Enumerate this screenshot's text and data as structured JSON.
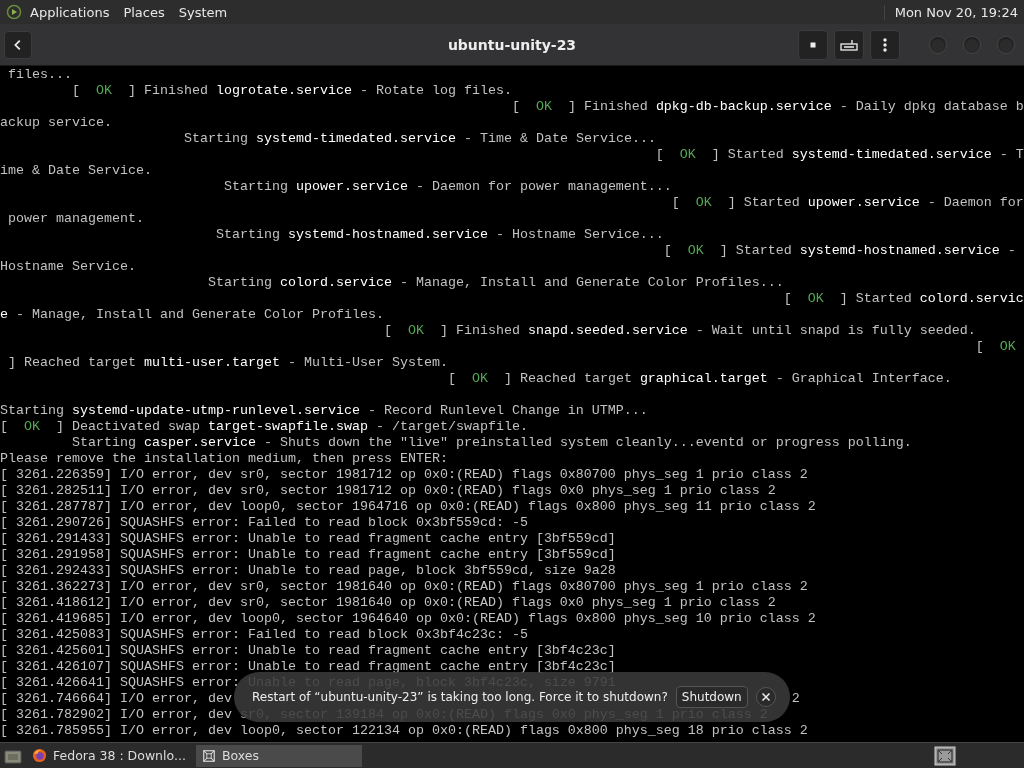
{
  "panel": {
    "menus": [
      "Applications",
      "Places",
      "System"
    ],
    "clock": "Mon Nov 20, 19:24"
  },
  "window": {
    "title": "ubuntu-unity-23"
  },
  "terminal": {
    "lines": [
      {
        "kind": "text",
        "text": " files..."
      },
      {
        "kind": "status",
        "text": "         [  ",
        "ok": "OK",
        "after": "  ] Finished **logrotate.service** - Rotate log files."
      },
      {
        "kind": "status",
        "text": "                                                                [  ",
        "ok": "OK",
        "after": "  ] Finished **dpkg-db-backup.service** - Daily dpkg database b"
      },
      {
        "kind": "text",
        "text": "ackup service."
      },
      {
        "kind": "text",
        "text": "                       Starting **systemd-timedated.service** - Time & Date Service..."
      },
      {
        "kind": "status",
        "text": "                                                                                  [  ",
        "ok": "OK",
        "after": "  ] Started **systemd-timedated.service** - T"
      },
      {
        "kind": "text",
        "text": "ime & Date Service."
      },
      {
        "kind": "text",
        "text": "                            Starting **upower.service** - Daemon for power management..."
      },
      {
        "kind": "status",
        "text": "                                                                                    [  ",
        "ok": "OK",
        "after": "  ] Started **upower.service** - Daemon for"
      },
      {
        "kind": "text",
        "text": " power management."
      },
      {
        "kind": "text",
        "text": "                           Starting **systemd-hostnamed.service** - Hostname Service..."
      },
      {
        "kind": "status",
        "text": "                                                                                   [  ",
        "ok": "OK",
        "after": "  ] Started **systemd-hostnamed.service** -"
      },
      {
        "kind": "text",
        "text": "Hostname Service."
      },
      {
        "kind": "text",
        "text": "                          Starting **colord.service** - Manage, Install and Generate Color Profiles..."
      },
      {
        "kind": "status",
        "text": "                                                                                                  [  ",
        "ok": "OK",
        "after": "  ] Started **colord.servic**"
      },
      {
        "kind": "text",
        "text": "**e** - Manage, Install and Generate Color Profiles."
      },
      {
        "kind": "status",
        "text": "                                                [  ",
        "ok": "OK",
        "after": "  ] Finished **snapd.seeded.service** - Wait until snapd is fully seeded."
      },
      {
        "kind": "status",
        "text": "                                                                                                                          [  ",
        "ok": "OK"
      },
      {
        "kind": "text",
        "text": " ] Reached target **multi-user.target** - Multi-User System."
      },
      {
        "kind": "status",
        "text": "                                                        [  ",
        "ok": "OK",
        "after": "  ] Reached target **graphical.target** - Graphical Interface."
      },
      {
        "kind": "blank"
      },
      {
        "kind": "text",
        "text": "Starting **systemd-update-utmp-runlevel.service** - Record Runlevel Change in UTMP..."
      },
      {
        "kind": "status",
        "text": "[  ",
        "ok": "OK",
        "after": "  ] Deactivated swap **target-swapfile.swap** - /target/swapfile."
      },
      {
        "kind": "text",
        "text": "         Starting **casper.service** - Shuts down the \"live\" preinstalled system cleanly...eventd or progress polling."
      },
      {
        "kind": "text",
        "text": "Please remove the installation medium, then press ENTER:"
      },
      {
        "kind": "text",
        "text": "[ 3261.226359] I/O error, dev sr0, sector 1981712 op 0x0:(READ) flags 0x80700 phys_seg 1 prio class 2"
      },
      {
        "kind": "text",
        "text": "[ 3261.282511] I/O error, dev sr0, sector 1981712 op 0x0:(READ) flags 0x0 phys_seg 1 prio class 2"
      },
      {
        "kind": "text",
        "text": "[ 3261.287787] I/O error, dev loop0, sector 1964716 op 0x0:(READ) flags 0x800 phys_seg 11 prio class 2"
      },
      {
        "kind": "text",
        "text": "[ 3261.290726] SQUASHFS error: Failed to read block 0x3bf559cd: -5"
      },
      {
        "kind": "text",
        "text": "[ 3261.291433] SQUASHFS error: Unable to read fragment cache entry [3bf559cd]"
      },
      {
        "kind": "text",
        "text": "[ 3261.291958] SQUASHFS error: Unable to read fragment cache entry [3bf559cd]"
      },
      {
        "kind": "text",
        "text": "[ 3261.292433] SQUASHFS error: Unable to read page, block 3bf559cd, size 9a28"
      },
      {
        "kind": "text",
        "text": "[ 3261.362273] I/O error, dev sr0, sector 1981640 op 0x0:(READ) flags 0x80700 phys_seg 1 prio class 2"
      },
      {
        "kind": "text",
        "text": "[ 3261.418612] I/O error, dev sr0, sector 1981640 op 0x0:(READ) flags 0x0 phys_seg 1 prio class 2"
      },
      {
        "kind": "text",
        "text": "[ 3261.419685] I/O error, dev loop0, sector 1964640 op 0x0:(READ) flags 0x800 phys_seg 10 prio class 2"
      },
      {
        "kind": "text",
        "text": "[ 3261.425083] SQUASHFS error: Failed to read block 0x3bf4c23c: -5"
      },
      {
        "kind": "text",
        "text": "[ 3261.425601] SQUASHFS error: Unable to read fragment cache entry [3bf4c23c]"
      },
      {
        "kind": "text",
        "text": "[ 3261.426107] SQUASHFS error: Unable to read fragment cache entry [3bf4c23c]"
      },
      {
        "kind": "text",
        "text": "[ 3261.426641] SQUASHFS error: Unable to read page, block 3bf4c23c, size 9791"
      },
      {
        "kind": "split",
        "text": "[ 3261.746664] I/O error, dev",
        "tail": "                                                                      2"
      },
      {
        "kind": "text",
        "text": "[ 3261.782902] I/O error, dev sr0, sector 139184 op 0x0:(READ) flags 0x0 phys_seg 1 prio class 2"
      },
      {
        "kind": "text",
        "text": "[ 3261.785955] I/O error, dev loop0, sector 122134 op 0x0:(READ) flags 0x800 phys_seg 18 prio class 2"
      }
    ]
  },
  "notification": {
    "message": "Restart of “ubuntu-unity-23” is taking too long. Force it to shutdown?",
    "button": "Shutdown"
  },
  "taskbar": {
    "tasks": [
      {
        "kind": "browser",
        "label": "Fedora 38 : Downlo...",
        "selected": false
      },
      {
        "kind": "boxes",
        "label": "Boxes",
        "selected": true
      }
    ]
  }
}
